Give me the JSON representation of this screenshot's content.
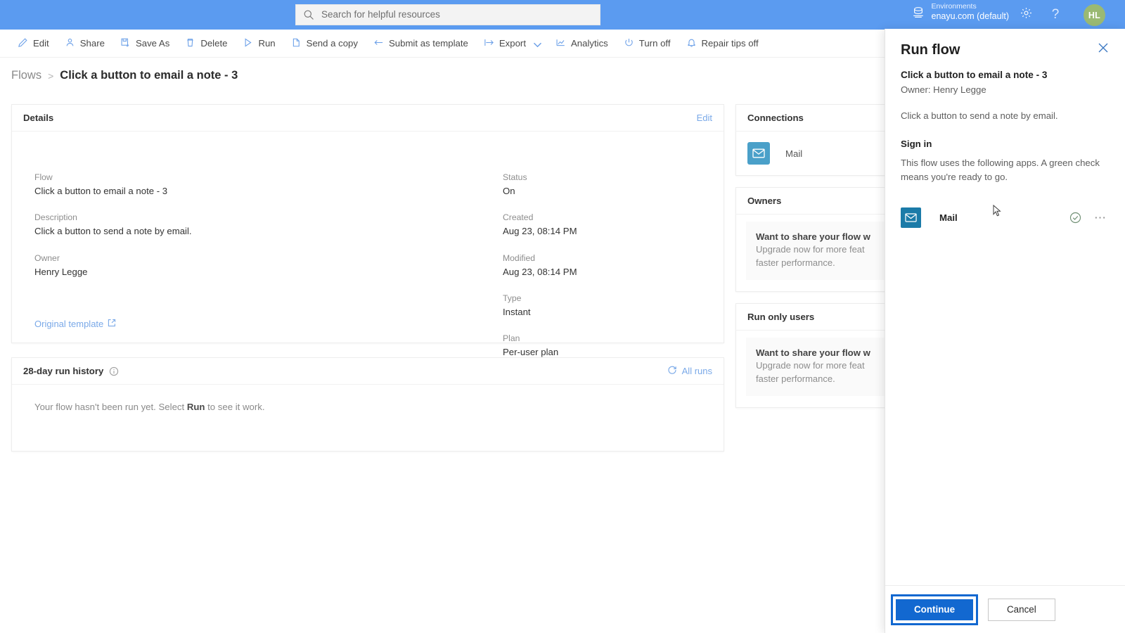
{
  "header": {
    "search_placeholder": "Search for helpful resources",
    "environments_label": "Environments",
    "environment_value": "enayu.com (default)",
    "avatar_initials": "HL",
    "help_glyph": "?",
    "brand_color": "#5b9bf0"
  },
  "command_bar": {
    "items": [
      {
        "label": "Edit",
        "icon": "pencil-icon"
      },
      {
        "label": "Share",
        "icon": "share-icon"
      },
      {
        "label": "Save As",
        "icon": "save-as-icon"
      },
      {
        "label": "Delete",
        "icon": "trash-icon"
      },
      {
        "label": "Run",
        "icon": "play-icon"
      },
      {
        "label": "Send a copy",
        "icon": "copy-icon"
      },
      {
        "label": "Submit as template",
        "icon": "submit-template-icon"
      },
      {
        "label": "Export",
        "icon": "export-icon"
      },
      {
        "label": "Analytics",
        "icon": "analytics-icon"
      },
      {
        "label": "Turn off",
        "icon": "power-icon"
      },
      {
        "label": "Repair tips off",
        "icon": "bell-icon"
      }
    ]
  },
  "breadcrumb": {
    "root": "Flows",
    "separator": ">",
    "current": "Click a button to email a note - 3"
  },
  "details": {
    "title": "Details",
    "edit_link": "Edit",
    "left_fields": [
      {
        "label": "Flow",
        "value": "Click a button to email a note - 3"
      },
      {
        "label": "Description",
        "value": "Click a button to send a note by email."
      },
      {
        "label": "Owner",
        "value": "Henry Legge"
      }
    ],
    "right_fields": [
      {
        "label": "Status",
        "value": "On"
      },
      {
        "label": "Created",
        "value": "Aug 23, 08:14 PM"
      },
      {
        "label": "Modified",
        "value": "Aug 23, 08:14 PM"
      },
      {
        "label": "Type",
        "value": "Instant"
      },
      {
        "label": "Plan",
        "value": "Per-user plan"
      }
    ],
    "original_template_link": "Original template"
  },
  "run_history": {
    "title": "28-day run history",
    "all_runs_label": "All runs",
    "empty_prefix": "Your flow hasn't been run yet. Select ",
    "empty_bold": "Run",
    "empty_suffix": " to see it work."
  },
  "connections": {
    "title": "Connections",
    "items": [
      {
        "name": "Mail",
        "icon": "mail-icon",
        "color": "#4aa0c9"
      }
    ]
  },
  "owners": {
    "title": "Owners",
    "upsell_title": "Want to share your flow w",
    "upsell_line1": "Upgrade now for more feat",
    "upsell_line2": "faster performance."
  },
  "run_only_users": {
    "title": "Run only users",
    "upsell_title": "Want to share your flow w",
    "upsell_line1": "Upgrade now for more feat",
    "upsell_line2": "faster performance."
  },
  "run_flow_panel": {
    "title": "Run flow",
    "flow_name": "Click a button to email a note - 3",
    "owner": "Owner: Henry Legge",
    "description": "Click a button to send a note by email.",
    "sign_in_heading": "Sign in",
    "sign_in_note": "This flow uses the following apps. A green check means you're ready to go.",
    "connection": {
      "name": "Mail",
      "icon": "mail-icon",
      "status_icon": "check-circle-icon",
      "overflow_icon": "more-icon",
      "color": "#1b7ba8",
      "check_color": "#6f8f73"
    },
    "continue_label": "Continue",
    "cancel_label": "Cancel",
    "primary_color": "#1268d0"
  }
}
